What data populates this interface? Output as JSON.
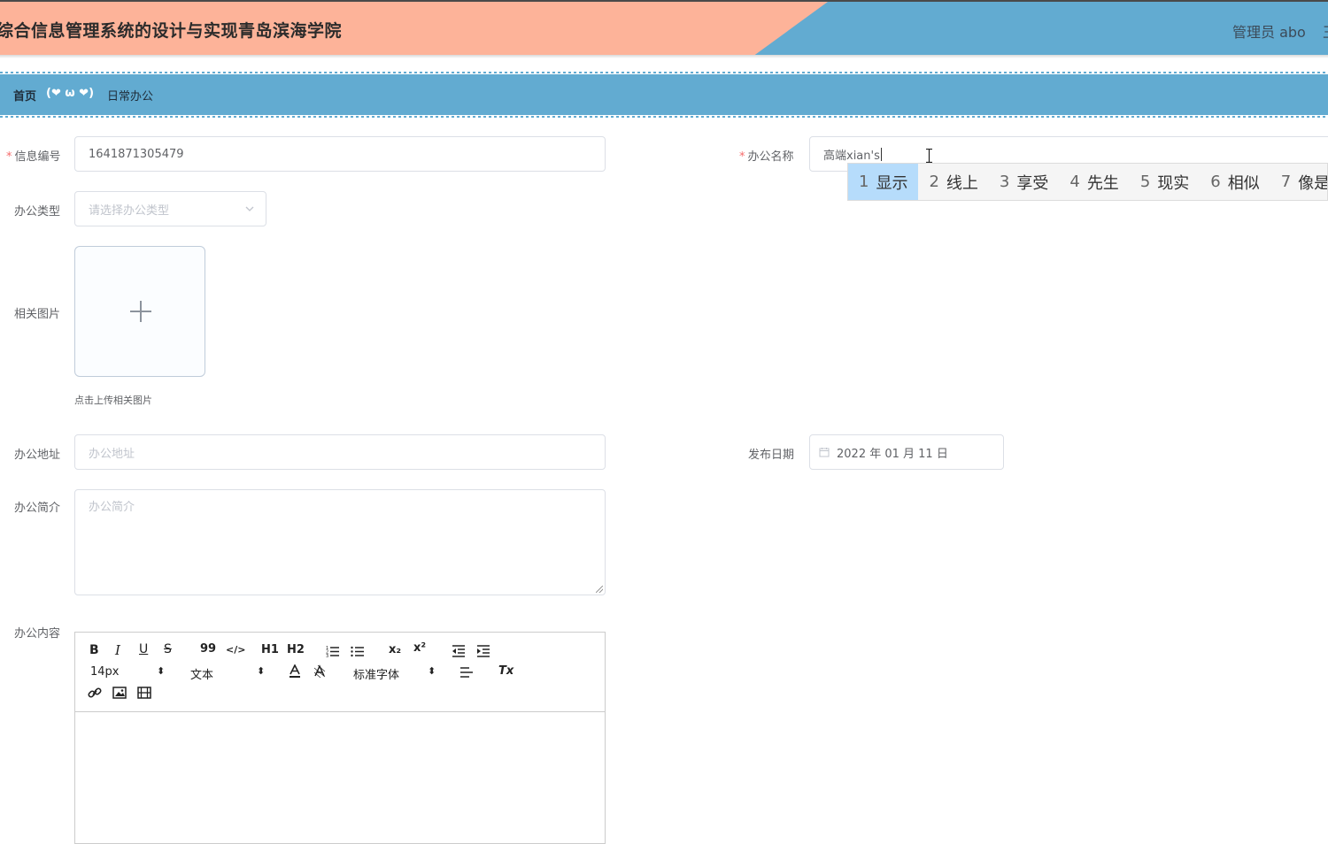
{
  "header": {
    "title": "综合信息管理系统的设计与实现青岛滨海学院",
    "user": "管理员 abo",
    "exit_glyph": "王"
  },
  "breadcrumb": {
    "home": "首页",
    "separator": "(❤ ω ❤)",
    "current": "日常办公"
  },
  "form": {
    "info_no": {
      "label": "信息编号",
      "value": "1641871305479"
    },
    "office_name": {
      "label": "办公名称",
      "value": "高端xian's"
    },
    "office_type": {
      "label": "办公类型",
      "placeholder": "请选择办公类型"
    },
    "image": {
      "label": "相关图片",
      "tip": "点击上传相关图片"
    },
    "address": {
      "label": "办公地址",
      "placeholder": "办公地址"
    },
    "publish_date": {
      "label": "发布日期",
      "value": "2022 年 01 月 11 日"
    },
    "intro": {
      "label": "办公简介",
      "placeholder": "办公简介"
    },
    "content": {
      "label": "办公内容"
    }
  },
  "ime": {
    "candidates": [
      {
        "num": "1",
        "text": "显示"
      },
      {
        "num": "2",
        "text": "线上"
      },
      {
        "num": "3",
        "text": "享受"
      },
      {
        "num": "4",
        "text": "先生"
      },
      {
        "num": "5",
        "text": "现实"
      },
      {
        "num": "6",
        "text": "相似"
      },
      {
        "num": "7",
        "text": "像是"
      }
    ]
  },
  "editor": {
    "font_size": "14px",
    "header_select": "文本",
    "font_family": "标准字体",
    "h1": "H1",
    "h2": "H2",
    "bold": "B",
    "italic": "I",
    "underline": "U",
    "strike": "S",
    "quote": "99",
    "code": "</>",
    "sub": "x₂",
    "sup": "x²",
    "clear": "Tx"
  },
  "colors": {
    "header_blue": "#62abd1",
    "header_salmon": "#fdb399",
    "required": "#f56c6c",
    "ime_selected": "#b6dcfb"
  }
}
